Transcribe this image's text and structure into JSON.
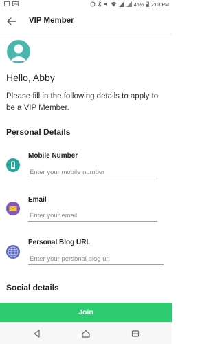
{
  "status_bar": {
    "battery": "46%",
    "time": "2:03 PM"
  },
  "app_bar": {
    "title": "VIP Member",
    "back_icon": "arrow-left-icon"
  },
  "profile": {
    "avatar_icon": "person-avatar-icon",
    "avatar_color": "#4db6ac",
    "greeting": "Hello, Abby"
  },
  "instructions": "Please fill in the following details to apply to be a VIP Member.",
  "personal_details": {
    "title": "Personal Details",
    "fields": [
      {
        "label": "Mobile Number",
        "placeholder": "Enter your mobile number",
        "value": "",
        "icon": "phone-icon",
        "icon_color": "#26a69a"
      },
      {
        "label": "Email",
        "placeholder": "Enter your email",
        "value": "",
        "icon": "envelope-icon",
        "icon_color": "#7e57c2"
      },
      {
        "label": "Personal Blog URL",
        "placeholder": "Enter your personal blog url",
        "value": "",
        "icon": "globe-icon",
        "icon_color": "#5c6bc0"
      }
    ]
  },
  "social_details": {
    "title": "Social details"
  },
  "join_button": {
    "label": "Join",
    "color": "#2ecc71"
  },
  "nav_bar": {
    "buttons": [
      "back-triangle-icon",
      "home-icon",
      "recents-icon"
    ]
  }
}
